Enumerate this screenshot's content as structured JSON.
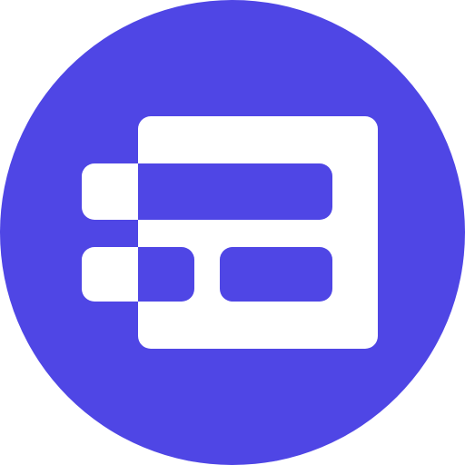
{
  "app_icon": {
    "icon_name": "form-layout-app-icon",
    "colors": {
      "brand": "#4F46E5",
      "foreground": "#FFFFFF"
    }
  }
}
